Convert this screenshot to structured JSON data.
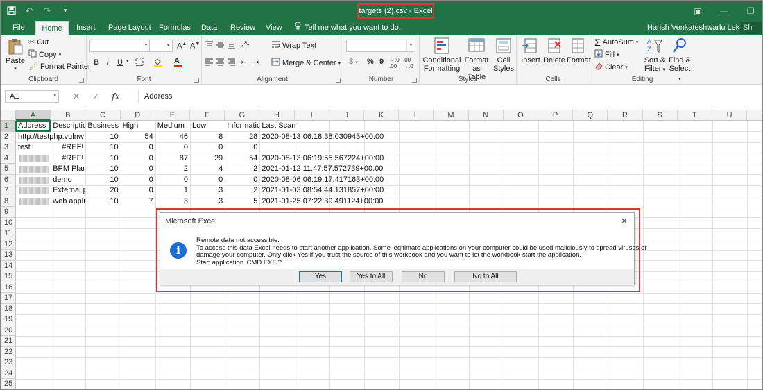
{
  "window": {
    "doc_title": "targets (2).csv - Excel",
    "user_name": "Harish Venkateshwarlu Lekkala",
    "share_label": "Sh"
  },
  "tabs": [
    "File",
    "Home",
    "Insert",
    "Page Layout",
    "Formulas",
    "Data",
    "Review",
    "View"
  ],
  "tell_me": "Tell me what you want to do...",
  "ribbon": {
    "clipboard": {
      "paste": "Paste",
      "cut": "Cut",
      "copy": "Copy",
      "format_painter": "Format Painter",
      "label": "Clipboard"
    },
    "font": {
      "label": "Font",
      "bold": "B",
      "italic": "I",
      "underline": "U"
    },
    "alignment": {
      "wrap_text": "Wrap Text",
      "merge_center": "Merge & Center",
      "label": "Alignment"
    },
    "number": {
      "currency": "$",
      "percent": "%",
      "comma": "9",
      "label": "Number"
    },
    "styles": {
      "conditional": "Conditional",
      "formatting": "Formatting",
      "format_as": "Format as",
      "table": "Table",
      "cell": "Cell",
      "styles_word": "Styles",
      "label": "Styles"
    },
    "cells": {
      "insert": "Insert",
      "delete": "Delete",
      "format": "Format",
      "label": "Cells"
    },
    "editing": {
      "autosum": "AutoSum",
      "fill": "Fill",
      "clear": "Clear",
      "sort_filter_1": "Sort &",
      "sort_filter_2": "Filter",
      "find_select_1": "Find &",
      "find_select_2": "Select",
      "label": "Editing"
    }
  },
  "formula_bar": {
    "name_box": "A1",
    "formula": "Address",
    "fx": "fx"
  },
  "columns": [
    "A",
    "B",
    "C",
    "D",
    "E",
    "F",
    "G",
    "H",
    "I",
    "J",
    "K",
    "L",
    "M",
    "N",
    "O",
    "P",
    "Q",
    "R",
    "S",
    "T",
    "U",
    "V"
  ],
  "rows": [
    "1",
    "2",
    "3",
    "4",
    "5",
    "6",
    "7",
    "8",
    "9",
    "10",
    "11",
    "12",
    "13",
    "14",
    "15",
    "16",
    "17",
    "18",
    "19",
    "20",
    "21",
    "22",
    "23",
    "24",
    "25",
    "26"
  ],
  "sheet": {
    "r1": {
      "a": "Address",
      "b": "Descriptic",
      "c": "Business C",
      "d": "High",
      "e": "Medium",
      "f": "Low",
      "g": "Informatic",
      "h": "Last Scan"
    },
    "r2": {
      "a": "http://testphp.vulnw",
      "c": "10",
      "d": "54",
      "e": "46",
      "f": "8",
      "g": "28",
      "h": "2020-08-13 06:18:38.030943+00:00"
    },
    "r3": {
      "a": "test",
      "b": "#REF!",
      "c": "10",
      "d": "0",
      "e": "0",
      "f": "0",
      "g": "0"
    },
    "r4": {
      "b": "#REF!",
      "c": "10",
      "d": "0",
      "e": "87",
      "f": "29",
      "g": "54",
      "h": "2020-08-13 06:19:55.567224+00:00"
    },
    "r5": {
      "b": "BPM Planr",
      "c": "10",
      "d": "0",
      "e": "2",
      "f": "4",
      "g": "2",
      "h": "2021-01-12 11:47:57.572739+00:00"
    },
    "r6": {
      "b": "demo",
      "c": "10",
      "d": "0",
      "e": "0",
      "f": "0",
      "g": "0",
      "h": "2020-08-06 06:19:17.417163+00:00"
    },
    "r7": {
      "b": "External p",
      "c": "20",
      "d": "0",
      "e": "1",
      "f": "3",
      "g": "2",
      "h": "2021-01-03 08:54:44.131857+00:00"
    },
    "r8": {
      "b": "web appli",
      "c": "10",
      "d": "7",
      "e": "3",
      "f": "3",
      "g": "5",
      "h": "2021-01-25 07:22:39.491124+00:00"
    }
  },
  "dialog": {
    "title": "Microsoft Excel",
    "line1": "Remote data not accessible.",
    "line2": "To access this data Excel needs to start another application. Some legitimate applications on your computer could be used maliciously to spread viruses or",
    "line3": "damage your computer. Only click Yes if you trust the source of this workbook and you want to let the workbook start the application.",
    "line4": "Start application 'CMD.EXE'?",
    "yes": "Yes",
    "yes_all": "Yes to All",
    "no": "No",
    "no_all": "No to All"
  }
}
